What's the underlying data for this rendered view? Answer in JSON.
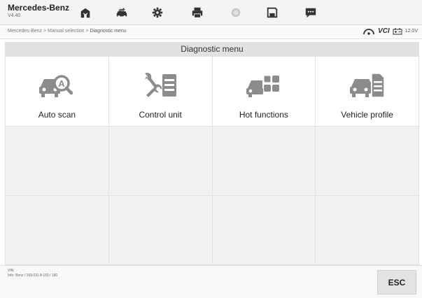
{
  "header": {
    "title": "Mercedes-Benz",
    "version": "V4.40"
  },
  "toolbar": [
    {
      "name": "home-icon"
    },
    {
      "name": "vehicle-swap-icon"
    },
    {
      "name": "gear-icon"
    },
    {
      "name": "print-icon"
    },
    {
      "name": "help-icon"
    },
    {
      "name": "save-icon"
    },
    {
      "name": "data-logging-icon"
    }
  ],
  "breadcrumb": {
    "part1": "Mercedes-Benz",
    "sep": ">",
    "part2": "Manual selection",
    "part3": "Diagnostic menu"
  },
  "status": {
    "vci_label": "VCI",
    "battery_voltage": "12.0V"
  },
  "main": {
    "title": "Diagnostic menu",
    "functions": [
      {
        "label": "Auto scan",
        "icon": "car-auto-scan-icon"
      },
      {
        "label": "Control unit",
        "icon": "control-unit-icon"
      },
      {
        "label": "Hot functions",
        "icon": "hot-functions-icon"
      },
      {
        "label": "Vehicle profile",
        "icon": "vehicle-profile-icon"
      }
    ]
  },
  "footer": {
    "vin_label": "VIN:",
    "info": "Info: Benz / 169.031 A 150 / 160",
    "esc_label": "ESC"
  },
  "colors": {
    "background": "#ffffff",
    "title_band": "#e2e2e2",
    "empty_cell": "#f1f1f1",
    "icon_gray": "#8c8c8c"
  }
}
